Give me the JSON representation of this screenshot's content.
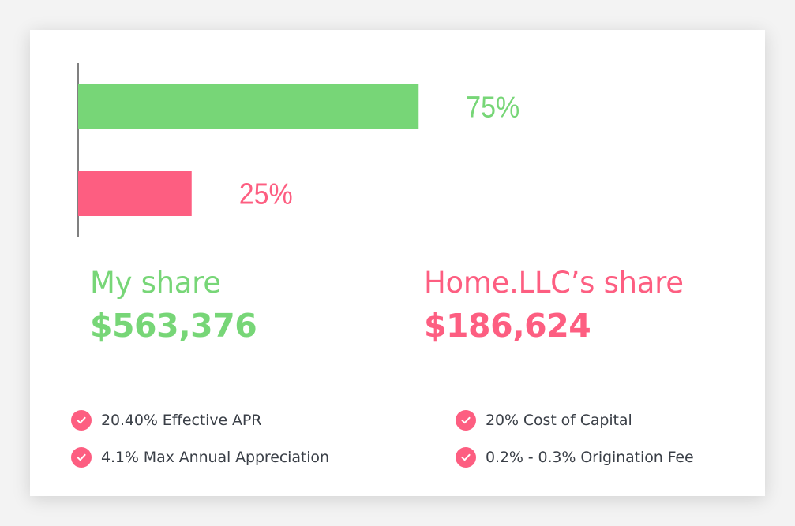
{
  "colors": {
    "mine": "#77d677",
    "home": "#fd5e81",
    "axis": "#000000",
    "feature_text": "#3a3f47"
  },
  "chart_data": {
    "type": "bar",
    "orientation": "horizontal",
    "categories": [
      "My share",
      "Home.LLC’s share"
    ],
    "values": [
      75,
      25
    ],
    "data_labels": [
      "75%",
      "25%"
    ],
    "xlim": [
      0,
      100
    ],
    "grid": false,
    "legend": "none"
  },
  "shares": {
    "mine": {
      "title": "My share",
      "amount": "$563,376"
    },
    "home": {
      "title": "Home.LLC’s share",
      "amount": "$186,624"
    }
  },
  "features": [
    {
      "text": "20.40% Effective APR",
      "icon": "check-circle-icon"
    },
    {
      "text": "20% Cost of Capital",
      "icon": "check-circle-icon"
    },
    {
      "text": "4.1% Max Annual Appreciation",
      "icon": "check-circle-icon"
    },
    {
      "text": "0.2% - 0.3% Origination Fee",
      "icon": "check-circle-icon"
    }
  ]
}
